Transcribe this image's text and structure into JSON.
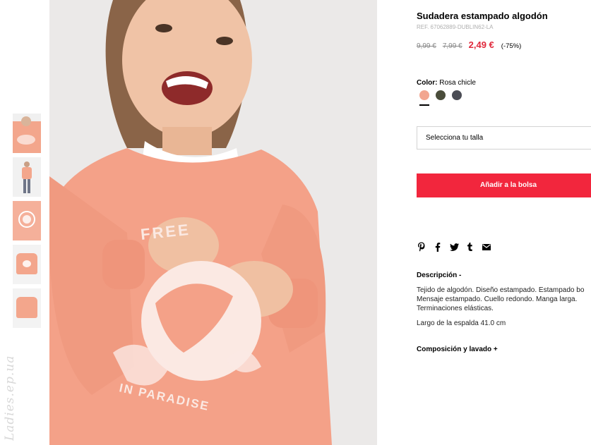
{
  "watermark": "Ladies.ep.ua",
  "product": {
    "title": "Sudadera estampado algodón",
    "ref": "REF. 67062889-DUBLIN62-LA",
    "prices": {
      "old1": "9,99 €",
      "old2": "7,99 €",
      "current": "2,49 €",
      "discount": "(-75%)"
    },
    "color": {
      "label": "Color:",
      "value": "Rosa chicle",
      "swatches": [
        "#f2a690",
        "#4a4d3b",
        "#4b4d55"
      ]
    },
    "size_select": "Selecciona tu talla",
    "add_button": "Añadir a la bolsa",
    "description_title": "Descripción -",
    "description_lines": [
      "Tejido de algodón. Diseño estampado. Estampado bo",
      "Mensaje estampado. Cuello redondo. Manga larga.",
      "Terminaciones elásticas."
    ],
    "back_length": "Largo de la espalda 41.0 cm",
    "composition": "Composición y lavado +"
  },
  "image": {
    "print_text_top": "FREE",
    "print_text_bottom": "IN PARADISE"
  },
  "social_icons": [
    "pinterest-icon",
    "facebook-icon",
    "twitter-icon",
    "tumblr-icon",
    "mail-icon"
  ],
  "colors": {
    "accent": "#f2263d",
    "price_red": "#e0283b",
    "sweater": "#f4a188"
  }
}
